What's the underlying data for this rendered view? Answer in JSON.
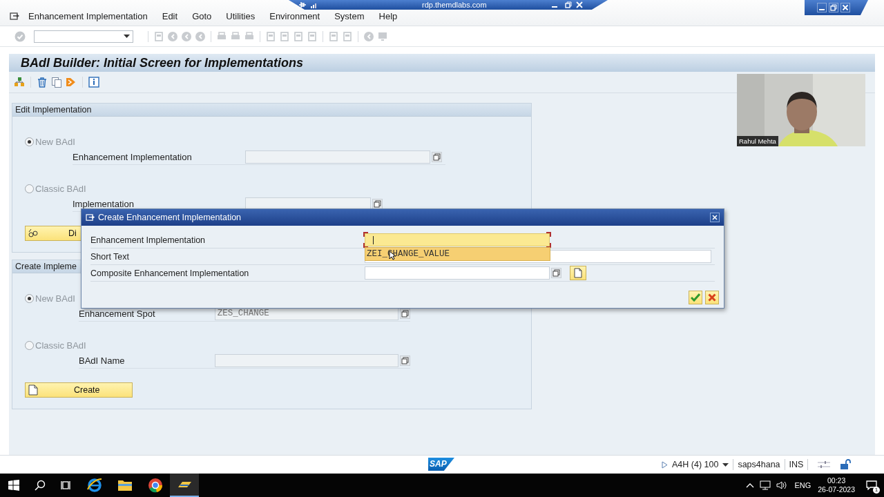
{
  "rdp_bar": {
    "host": "rdp.themdlabs.com"
  },
  "menu_bar": {
    "items": [
      "Enhancement Implementation",
      "Edit",
      "Goto",
      "Utilities",
      "Environment",
      "System",
      "Help"
    ]
  },
  "title": "BAdI Builder: Initial Screen for Implementations",
  "edit_section": {
    "title": "Edit Implementation",
    "options": [
      {
        "label": "New BAdI",
        "selected": true,
        "disabled": true,
        "field_label": "Enhancement Implementation"
      },
      {
        "label": "Classic BAdI",
        "selected": false,
        "disabled": true,
        "field_label": "Implementation"
      }
    ],
    "button": "Di"
  },
  "create_section": {
    "title": "Create Impleme",
    "options": [
      {
        "label": "New BAdI",
        "selected": true,
        "disabled": true,
        "field_label": "Enhancement Spot",
        "value": "ZES_CHANGE"
      },
      {
        "label": "Classic BAdI",
        "selected": false,
        "disabled": true,
        "field_label": "BAdI Name"
      }
    ],
    "button": "Create"
  },
  "dialog": {
    "title": "Create Enhancement Implementation",
    "fields": [
      {
        "label": "Enhancement Implementation",
        "focused": true
      },
      {
        "label": "Short Text",
        "focused": false
      },
      {
        "label": "Composite Enhancement Implementation",
        "focused": false
      }
    ],
    "suggestion": "ZEI_CHANGE_VALUE"
  },
  "webcam": {
    "kind": "picture",
    "name": "Rahul Mehta"
  },
  "status_bar": {
    "logo": "SAP",
    "system": "A4H (4) 100",
    "server": "saps4hana",
    "mode": "INS"
  },
  "taskbar": {
    "language": "ENG",
    "time": "00:23",
    "date": "26-07-2023",
    "notifications": "1"
  }
}
